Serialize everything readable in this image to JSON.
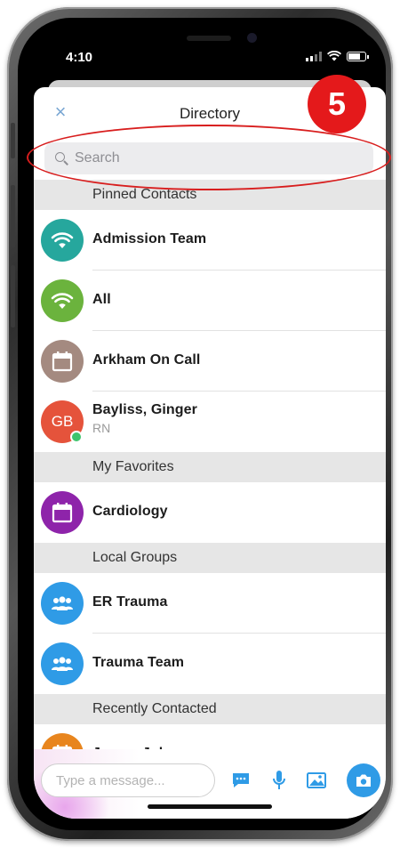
{
  "status_bar": {
    "time": "4:10"
  },
  "nav": {
    "close_glyph": "×",
    "title": "Directory"
  },
  "search": {
    "placeholder": "Search",
    "value": ""
  },
  "sections": [
    {
      "header": "Pinned Contacts",
      "rows": [
        {
          "name": "Admission Team",
          "sub": "",
          "initials": "",
          "icon": "wifi-icon",
          "color": "#26a79d"
        },
        {
          "name": "All",
          "sub": "",
          "initials": "",
          "icon": "wifi-icon",
          "color": "#6bb33d"
        },
        {
          "name": "Arkham On Call",
          "sub": "",
          "initials": "",
          "icon": "calendar-icon",
          "color": "#a48a80"
        },
        {
          "name": "Bayliss, Ginger",
          "sub": "RN",
          "initials": "GB",
          "icon": "",
          "color": "#e5533b",
          "online": true
        }
      ]
    },
    {
      "header": "My Favorites",
      "rows": [
        {
          "name": "Cardiology",
          "sub": "",
          "initials": "",
          "icon": "calendar-icon",
          "color": "#8e24aa"
        }
      ]
    },
    {
      "header": "Local Groups",
      "rows": [
        {
          "name": "ER Trauma",
          "sub": "",
          "initials": "",
          "icon": "group-icon",
          "color": "#2f9be6"
        },
        {
          "name": "Trauma Team",
          "sub": "",
          "initials": "",
          "icon": "group-icon",
          "color": "#2f9be6"
        }
      ]
    },
    {
      "header": "Recently Contacted",
      "rows": [
        {
          "name": "Jones, John",
          "sub": "",
          "initials": "",
          "icon": "calendar-icon",
          "color": "#e8851e"
        }
      ]
    }
  ],
  "composer": {
    "placeholder": "Type a message..."
  },
  "toolbar_icons": [
    "chat-icon",
    "microphone-icon",
    "image-icon",
    "camera-icon"
  ],
  "annotation": {
    "badge_number": "5",
    "color": "#e4191b"
  },
  "colors": {
    "accent": "#2f9be6",
    "close": "#7aa7d3"
  }
}
